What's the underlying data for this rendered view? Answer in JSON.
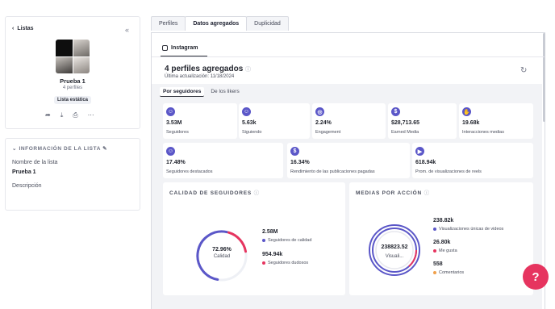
{
  "sidebar": {
    "back_label": "Listas",
    "list_name": "Prueba 1",
    "profile_count": "4 perfiles",
    "badge": "Lista estática",
    "info_title": "INFORMACIÓN DE LA LISTA",
    "name_label": "Nombre de la lista",
    "name_value": "Prueba 1",
    "description_label": "Descripción"
  },
  "tabs": [
    "Perfiles",
    "Datos agregados",
    "Duplicidad"
  ],
  "network_tab": "Instagram",
  "header": {
    "title": "4 perfiles agregados",
    "updated": "Última actualización: 11/18/2024"
  },
  "subtabs": [
    "Por seguidores",
    "De los likers"
  ],
  "stats_row1": [
    {
      "icon": "users-icon",
      "value": "3.53M",
      "label": "Seguidores"
    },
    {
      "icon": "user-follow-icon",
      "value": "5.63k",
      "label": "Siguiendo"
    },
    {
      "icon": "target-icon",
      "value": "2.24%",
      "label": "Engagement"
    },
    {
      "icon": "dollar-icon",
      "value": "$28,713.65",
      "label": "Earned Media"
    },
    {
      "icon": "hand-icon",
      "value": "19.68k",
      "label": "Interacciones medias"
    }
  ],
  "stats_row2": [
    {
      "icon": "user-star-icon",
      "value": "17.48%",
      "label": "Seguidores destacados"
    },
    {
      "icon": "dollar-icon",
      "value": "16.34%",
      "label": "Rendimiento de las publicaciones pagadas"
    },
    {
      "icon": "play-icon",
      "value": "618.94k",
      "label": "Prom. de visualizaciones de reels"
    }
  ],
  "quality": {
    "title": "CALIDAD DE SEGUIDORES",
    "center_value": "72.96%",
    "center_label": "Calidad",
    "items": [
      {
        "value": "2.58M",
        "label": "Seguidores de calidad",
        "color": "#5b57c8"
      },
      {
        "value": "954.94k",
        "label": "Seguidores dudosos",
        "color": "#e6345f"
      }
    ],
    "fraction": 0.7296
  },
  "media": {
    "title": "MEDIAS POR ACCIÓN",
    "center_value": "238823.52",
    "center_label": "Visuali...",
    "items": [
      {
        "value": "238.82k",
        "label": "Visualizaciones únicas de videos",
        "color": "#5b57c8"
      },
      {
        "value": "26.80k",
        "label": "Me gusta",
        "color": "#e6345f"
      },
      {
        "value": "558",
        "label": "Comentarios",
        "color": "#f0a04b"
      }
    ]
  },
  "colors": {
    "accent": "#5b57c8",
    "danger": "#e6345f",
    "orange": "#f0a04b"
  }
}
